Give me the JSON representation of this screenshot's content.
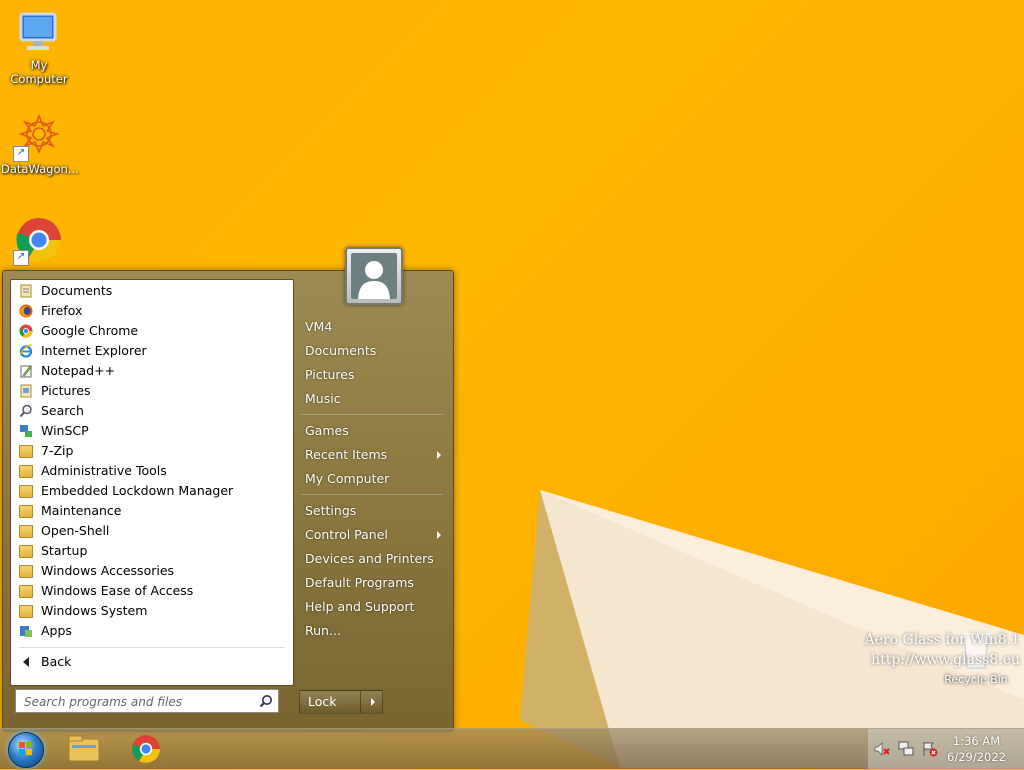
{
  "desktop": {
    "icons": [
      {
        "label": "My Computer"
      },
      {
        "label": "DataWagon..."
      },
      {
        "label": ""
      }
    ],
    "recycle_bin": "Recycle Bin",
    "watermark_line1": "Aero Glass for Win8.1",
    "watermark_line2": "http://www.glass8.eu"
  },
  "start_menu": {
    "programs": [
      {
        "label": "Documents",
        "icon": "documents-icon"
      },
      {
        "label": "Firefox",
        "icon": "firefox-icon"
      },
      {
        "label": "Google Chrome",
        "icon": "chrome-icon"
      },
      {
        "label": "Internet Explorer",
        "icon": "ie-icon"
      },
      {
        "label": "Notepad++",
        "icon": "notepadpp-icon"
      },
      {
        "label": "Pictures",
        "icon": "pictures-icon"
      },
      {
        "label": "Search",
        "icon": "search-icon"
      },
      {
        "label": "WinSCP",
        "icon": "winscp-icon"
      },
      {
        "label": "7-Zip",
        "icon": "folder-icon"
      },
      {
        "label": "Administrative Tools",
        "icon": "folder-icon"
      },
      {
        "label": "Embedded Lockdown Manager",
        "icon": "folder-icon"
      },
      {
        "label": "Maintenance",
        "icon": "folder-icon"
      },
      {
        "label": "Open-Shell",
        "icon": "folder-icon"
      },
      {
        "label": "Startup",
        "icon": "folder-icon"
      },
      {
        "label": "Windows Accessories",
        "icon": "folder-icon"
      },
      {
        "label": "Windows Ease of Access",
        "icon": "folder-icon"
      },
      {
        "label": "Windows System",
        "icon": "folder-icon"
      },
      {
        "label": "Apps",
        "icon": "apps-icon"
      }
    ],
    "back_label": "Back",
    "search_placeholder": "Search programs and files",
    "right_items": {
      "user": "VM4",
      "documents": "Documents",
      "pictures": "Pictures",
      "music": "Music",
      "games": "Games",
      "recent": "Recent Items",
      "computer": "My Computer",
      "settings": "Settings",
      "control_panel": "Control Panel",
      "devices": "Devices and Printers",
      "defaults": "Default Programs",
      "help": "Help and Support",
      "run": "Run..."
    },
    "lock_label": "Lock"
  },
  "taskbar": {
    "time": "1:36 AM",
    "date": "6/29/2022"
  },
  "colors": {
    "wallpaper": "#ffb400",
    "menu_glass": "#8c7640"
  }
}
